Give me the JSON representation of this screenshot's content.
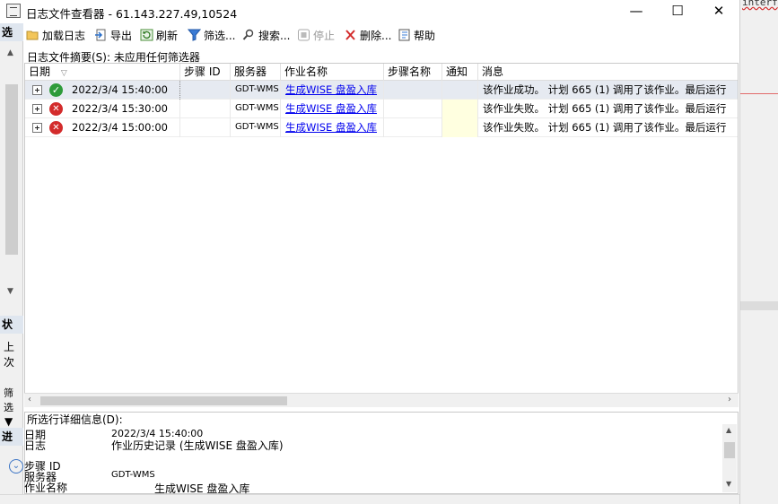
{
  "window": {
    "title": "日志文件查看器 - 61.143.227.49,10524",
    "minimize": "—",
    "maximize": "☐",
    "close": "✕"
  },
  "toolbar": {
    "load_log": "加载日志",
    "export": "导出",
    "refresh": "刷新",
    "filter": "筛选...",
    "search": "搜索...",
    "stop": "停止",
    "delete": "删除...",
    "help": "帮助"
  },
  "left_panel": {
    "select_header": "选",
    "status_header": "状",
    "last_text": "上次",
    "filter_text": "筛选",
    "progress_header": "进"
  },
  "summary": "日志文件摘要(S): 未应用任何筛选器",
  "grid": {
    "columns": [
      "日期",
      "步骤 ID",
      "服务器",
      "作业名称",
      "步骤名称",
      "通知",
      "消息"
    ],
    "rows": [
      {
        "status": "success",
        "date": "2022/3/4 15:40:00",
        "step_id": "",
        "server": "GDT-WMS",
        "job": "生成WISE 盘盈入库",
        "step_name": "",
        "notify": "",
        "message": "该作业成功。  计划 665 (1) 调用了该作业。最后运行"
      },
      {
        "status": "failure",
        "date": "2022/3/4 15:30:00",
        "step_id": "",
        "server": "GDT-WMS",
        "job": "生成WISE 盘盈入库",
        "step_name": "",
        "notify": "",
        "message": "该作业失败。  计划 665 (1) 调用了该作业。最后运行"
      },
      {
        "status": "failure",
        "date": "2022/3/4 15:00:00",
        "step_id": "",
        "server": "GDT-WMS",
        "job": "生成WISE 盘盈入库",
        "step_name": "",
        "notify": "",
        "message": "该作业失败。  计划 665 (1) 调用了该作业。最后运行"
      }
    ]
  },
  "details": {
    "label": "所选行详细信息(D):",
    "date_label": "日期",
    "date_value": "2022/3/4 15:40:00",
    "log_label": "日志",
    "log_value": "作业历史记录 (生成WISE 盘盈入库)",
    "step_label": "步骤 ID",
    "server_label": "服务器",
    "server_value": "GDT-WMS",
    "job_label": "作业名称",
    "job_value": "生成WISE 盘盈入库"
  },
  "right_panel": {
    "fragment": "interf"
  },
  "colors": {
    "link": "#0000ee",
    "selected_row": "#e6eaf1",
    "success": "#2e9b3a",
    "failure": "#d32b2b",
    "notify_highlight": "#ffffe0"
  }
}
